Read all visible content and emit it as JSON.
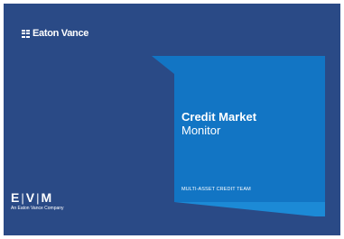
{
  "brand": {
    "name": "Eaton Vance",
    "icon": "eaton-vance-grid-icon"
  },
  "cover": {
    "title_line1": "Credit Market",
    "title_line2": "Monitor",
    "team": "MULTI-ASSET CREDIT TEAM"
  },
  "footer_logo": {
    "mark_e": "E",
    "mark_sep": "|",
    "mark_v": "V",
    "mark_m": "M",
    "tagline": "An Eaton Vance Company"
  },
  "colors": {
    "background": "#2a4a86",
    "accent_blue": "#1275c4",
    "accent_light": "#1c8ad6"
  }
}
